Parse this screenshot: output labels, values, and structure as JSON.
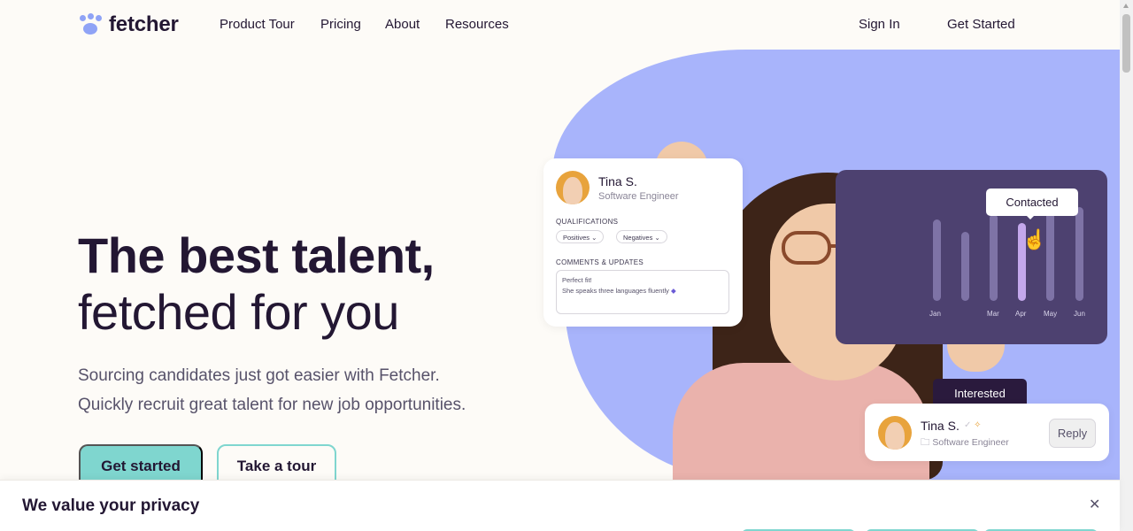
{
  "header": {
    "logo_text": "fetcher",
    "nav": [
      "Product Tour",
      "Pricing",
      "About",
      "Resources"
    ],
    "sign_in": "Sign In",
    "get_started": "Get Started"
  },
  "hero": {
    "title_line1": "The best talent,",
    "title_line2": "fetched for you",
    "subtitle_line1": "Sourcing candidates just got easier with Fetcher.",
    "subtitle_line2": "Quickly recruit great talent for new job opportunities.",
    "primary_button": "Get started",
    "secondary_button": "Take a tour"
  },
  "profile_card": {
    "name": "Tina S.",
    "role": "Software Engineer",
    "qualifications_label": "QUALIFICATIONS",
    "chips": [
      "Positives",
      "Negatives"
    ],
    "comments_label": "COMMENTS & UPDATES",
    "comment_line1": "Perfect fit!",
    "comment_line2": "She speaks three languages fluently"
  },
  "chart_card": {
    "months": [
      "Jan",
      "Mar",
      "Apr",
      "May",
      "Jun"
    ],
    "tooltip": "Contacted"
  },
  "reply_card": {
    "tooltip": "Interested",
    "name": "Tina S.",
    "role": "Software Engineer",
    "reply": "Reply"
  },
  "privacy": {
    "title": "We value your privacy"
  },
  "colors": {
    "accent": "#7fd6cf",
    "blob": "#a8b4fb",
    "text": "#231733",
    "chart_bg": "#4d4170"
  }
}
